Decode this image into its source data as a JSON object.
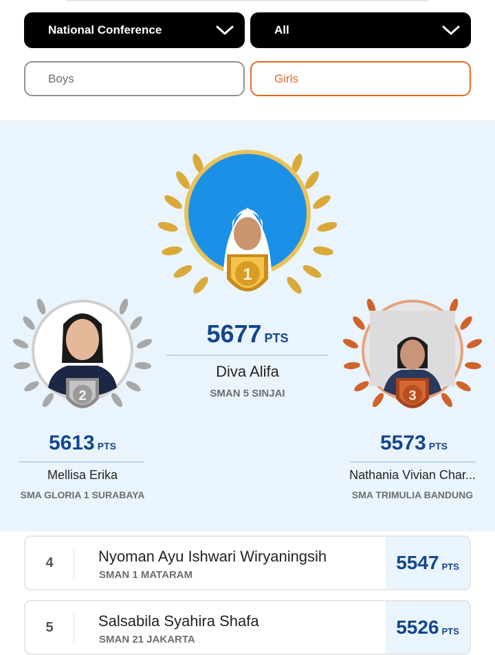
{
  "filters": {
    "conference": "National Conference",
    "region": "All"
  },
  "gender_tabs": {
    "boys": "Boys",
    "girls": "Girls",
    "selected": "girls"
  },
  "colors": {
    "accent_orange": "#e06a20",
    "score_blue": "#12468c",
    "podium_bg": "#eaf4fc",
    "gold": "#d9a93a",
    "silver": "#a8a8a8",
    "bronze": "#d0632a"
  },
  "podium": {
    "first": {
      "rank": "1",
      "points": "5677",
      "unit": "PTS",
      "name": "Diva Alifa",
      "school": "SMAN 5 SINJAI"
    },
    "second": {
      "rank": "2",
      "points": "5613",
      "unit": "PTS",
      "name": "Mellisa Erika",
      "school": "SMA GLORIA 1 SURABAYA"
    },
    "third": {
      "rank": "3",
      "points": "5573",
      "unit": "PTS",
      "name": "Nathania Vivian Char...",
      "school": "SMA TRIMULIA BANDUNG"
    }
  },
  "rankings": [
    {
      "rank": "4",
      "name": "Nyoman Ayu Ishwari Wiryaningsih",
      "school": "SMAN 1 MATARAM",
      "points": "5547",
      "unit": "PTS"
    },
    {
      "rank": "5",
      "name": "Salsabila Syahira Shafa",
      "school": "SMAN 21 JAKARTA",
      "points": "5526",
      "unit": "PTS"
    }
  ]
}
